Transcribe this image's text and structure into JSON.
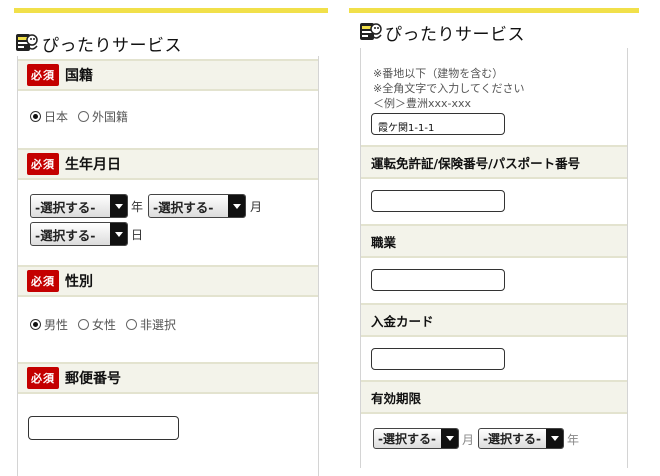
{
  "app": {
    "title": "ぴったりサービス",
    "badge_required": "必須"
  },
  "left": {
    "sections": {
      "nationality": {
        "label": "国籍",
        "options": [
          "日本",
          "外国籍"
        ],
        "selected": "日本"
      },
      "birthdate": {
        "label": "生年月日",
        "year_select": "-選択する-",
        "year_unit": "年",
        "month_select": "-選択する-",
        "month_unit": "月",
        "day_select": "-選択する-",
        "day_unit": "日"
      },
      "gender": {
        "label": "性別",
        "options": [
          "男性",
          "女性",
          "非選択"
        ],
        "selected": "男性"
      },
      "postal": {
        "label": "郵便番号",
        "value": ""
      }
    }
  },
  "right": {
    "address": {
      "notes": [
        "※番地以下（建物を含む）",
        "※全角文字で入力してください",
        "＜例＞豊洲xxx-xxx"
      ],
      "value": "霞ケ関1-1-1"
    },
    "license": {
      "label": "運転免許証/保険番号/パスポート番号",
      "value": ""
    },
    "occupation": {
      "label": "職業",
      "value": ""
    },
    "card": {
      "label": "入金カード",
      "value": ""
    },
    "expiry": {
      "label": "有効期限",
      "month_select": "-選択する-",
      "month_unit": "月",
      "year_select": "-選択する-",
      "year_unit": "年"
    }
  },
  "colors": {
    "accent_bar": "#f1e04a",
    "required_badge": "#c40000"
  },
  "icons": {
    "logo": "mascot-logo-icon",
    "select_arrow": "dropdown-arrow-icon"
  }
}
